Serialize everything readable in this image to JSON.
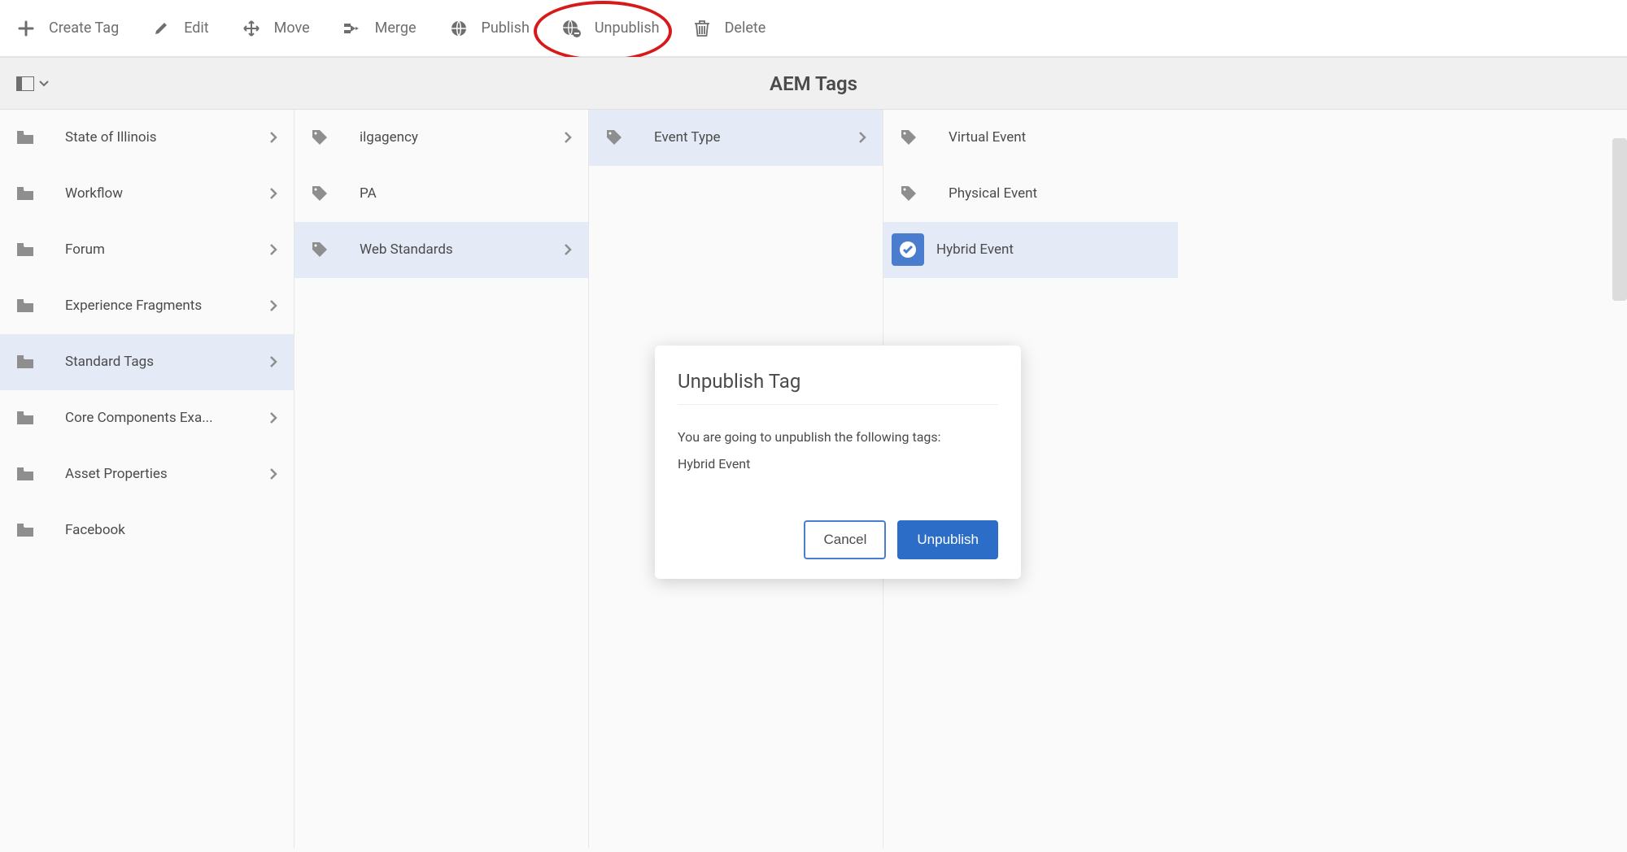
{
  "toolbar": {
    "create": "Create Tag",
    "edit": "Edit",
    "move": "Move",
    "merge": "Merge",
    "publish": "Publish",
    "unpublish": "Unpublish",
    "delete": "Delete"
  },
  "header": {
    "title": "AEM Tags"
  },
  "columns": [
    {
      "items": [
        {
          "label": "State of Illinois",
          "icon": "folder",
          "hasChildren": true,
          "selected": false
        },
        {
          "label": "Workflow",
          "icon": "folder",
          "hasChildren": true,
          "selected": false
        },
        {
          "label": "Forum",
          "icon": "folder",
          "hasChildren": true,
          "selected": false
        },
        {
          "label": "Experience Fragments",
          "icon": "folder",
          "hasChildren": true,
          "selected": false
        },
        {
          "label": "Standard Tags",
          "icon": "folder",
          "hasChildren": true,
          "selected": true
        },
        {
          "label": "Core Components Exa...",
          "icon": "folder",
          "hasChildren": true,
          "selected": false
        },
        {
          "label": "Asset Properties",
          "icon": "folder",
          "hasChildren": true,
          "selected": false
        },
        {
          "label": "Facebook",
          "icon": "folder",
          "hasChildren": false,
          "selected": false
        }
      ]
    },
    {
      "items": [
        {
          "label": "ilgagency",
          "icon": "tag",
          "hasChildren": true,
          "selected": false
        },
        {
          "label": "PA",
          "icon": "tag",
          "hasChildren": false,
          "selected": false
        },
        {
          "label": "Web Standards",
          "icon": "tag",
          "hasChildren": true,
          "selected": true
        }
      ]
    },
    {
      "items": [
        {
          "label": "Event Type",
          "icon": "tag",
          "hasChildren": true,
          "selected": true
        }
      ]
    },
    {
      "items": [
        {
          "label": "Virtual Event",
          "icon": "tag",
          "hasChildren": false,
          "selected": false
        },
        {
          "label": "Physical Event",
          "icon": "tag",
          "hasChildren": false,
          "selected": false
        },
        {
          "label": "Hybrid Event",
          "icon": "tag",
          "hasChildren": false,
          "selected": false,
          "checked": true
        }
      ]
    }
  ],
  "dialog": {
    "title": "Unpublish Tag",
    "message": "You are going to unpublish the following tags:",
    "tag": "Hybrid Event",
    "cancel": "Cancel",
    "confirm": "Unpublish"
  }
}
